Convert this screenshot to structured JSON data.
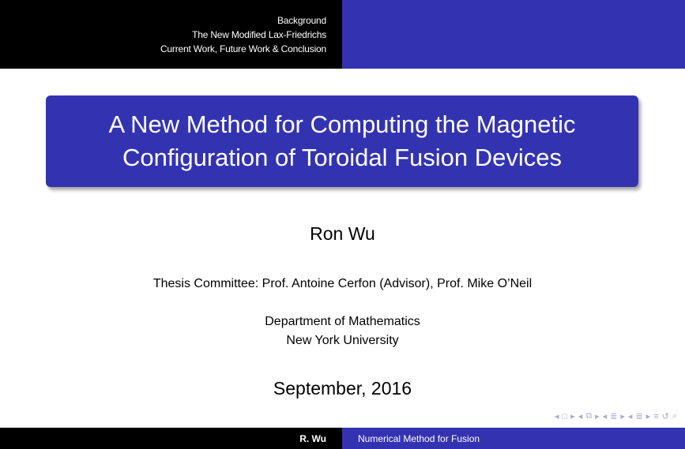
{
  "header": {
    "sections": [
      "Background",
      "The New Modified Lax-Friedrichs",
      "Current Work, Future Work & Conclusion"
    ]
  },
  "title": {
    "line1": "A New Method for Computing the Magnetic",
    "line2": "Configuration of Toroidal Fusion Devices"
  },
  "author": "Ron Wu",
  "committee": "Thesis Committee: Prof. Antoine Cerfon (Advisor), Prof. Mike O’Neil",
  "institute": {
    "line1": "Department of Mathematics",
    "line2": "New York University"
  },
  "date": "September, 2016",
  "footer": {
    "author_short": "R. Wu",
    "title_short": "Numerical Method for Fusion"
  },
  "nav": {
    "icons": [
      "nav-prev-frame-icon",
      "nav-frame-icon",
      "nav-next-frame-icon",
      "nav-prev-subsection-icon",
      "nav-subsection-icon",
      "nav-next-subsection-icon",
      "nav-prev-section-icon",
      "nav-section-icon",
      "nav-next-section-icon",
      "nav-toc-icon",
      "nav-back-icon",
      "nav-search-icon"
    ]
  },
  "colors": {
    "structure_blue": "#3333b2",
    "black": "#000000",
    "nav_symbol": "#a9a9d6"
  }
}
